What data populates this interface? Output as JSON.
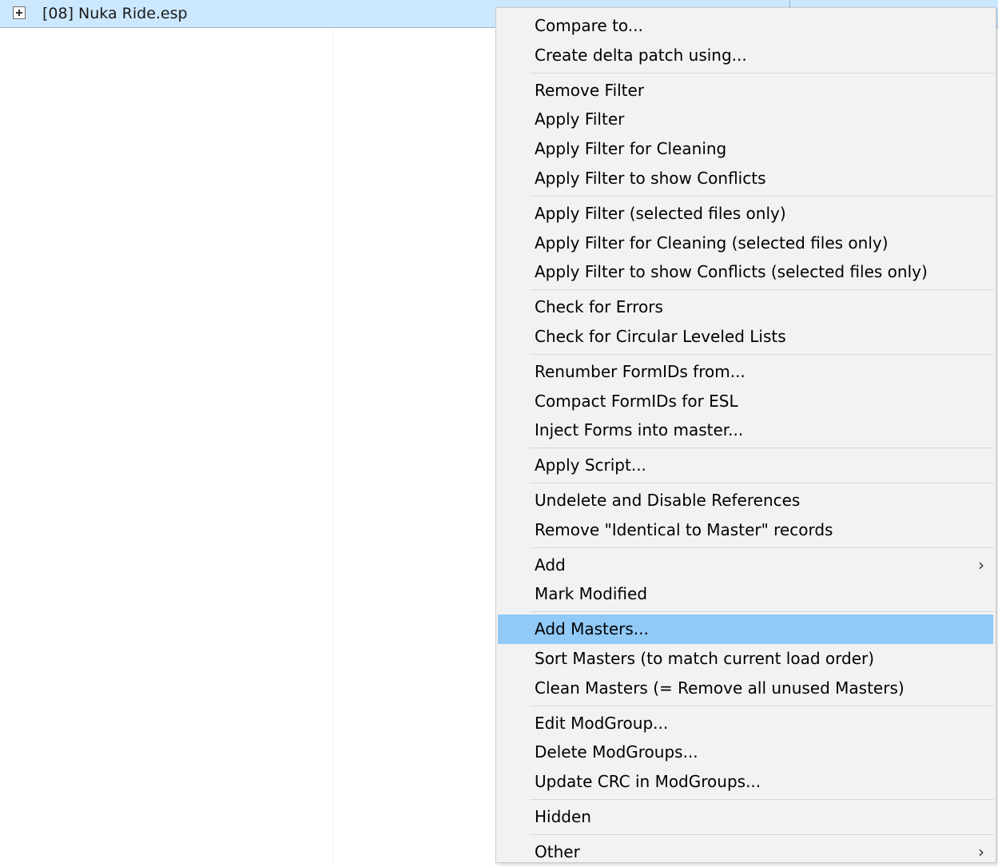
{
  "tree": {
    "selected_row": {
      "label": "[08] Nuka Ride.esp",
      "expander_icon": "plus-box-icon"
    }
  },
  "context_menu": {
    "groups": [
      [
        {
          "label": "Compare to..."
        },
        {
          "label": "Create delta patch using..."
        }
      ],
      [
        {
          "label": "Remove Filter"
        },
        {
          "label": "Apply Filter"
        },
        {
          "label": "Apply Filter for Cleaning"
        },
        {
          "label": "Apply Filter to show Conflicts"
        }
      ],
      [
        {
          "label": "Apply Filter (selected files only)"
        },
        {
          "label": "Apply Filter for Cleaning (selected files only)"
        },
        {
          "label": "Apply Filter to show Conflicts (selected files only)"
        }
      ],
      [
        {
          "label": "Check for Errors"
        },
        {
          "label": "Check for Circular Leveled Lists"
        }
      ],
      [
        {
          "label": "Renumber FormIDs from..."
        },
        {
          "label": "Compact FormIDs for ESL"
        },
        {
          "label": "Inject Forms into master..."
        }
      ],
      [
        {
          "label": "Apply Script..."
        }
      ],
      [
        {
          "label": "Undelete and Disable References"
        },
        {
          "label": "Remove \"Identical to Master\" records"
        }
      ],
      [
        {
          "label": "Add",
          "submenu": true,
          "icon": "chevron-right-icon"
        },
        {
          "label": "Mark Modified"
        }
      ],
      [
        {
          "label": "Add Masters...",
          "highlighted": true
        },
        {
          "label": "Sort Masters (to match current load order)"
        },
        {
          "label": "Clean Masters (= Remove all unused Masters)"
        }
      ],
      [
        {
          "label": "Edit ModGroup..."
        },
        {
          "label": "Delete ModGroups..."
        },
        {
          "label": "Update CRC in ModGroups..."
        }
      ],
      [
        {
          "label": "Hidden"
        }
      ],
      [
        {
          "label": "Other",
          "submenu": true,
          "icon": "chevron-right-icon"
        }
      ]
    ],
    "chevron_glyph": "›"
  },
  "colors": {
    "selection": "#cce8ff",
    "menu_background": "#f2f2f2",
    "menu_highlight": "#91c9f7",
    "separator": "#d7d7d7"
  }
}
